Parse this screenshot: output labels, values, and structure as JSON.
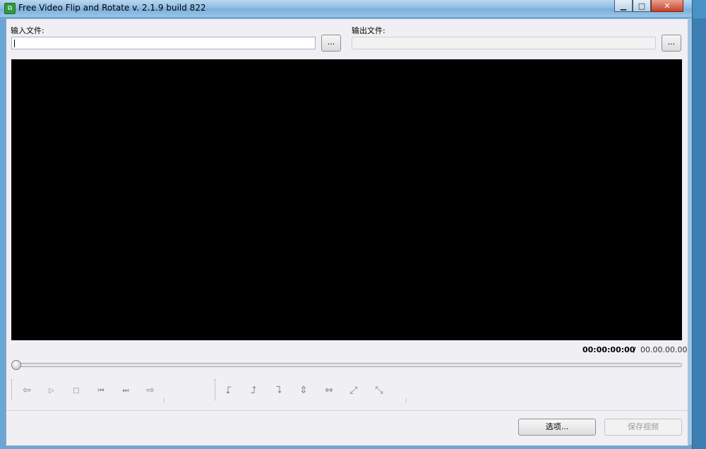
{
  "window": {
    "title": "Free Video Flip and Rotate  v. 2.1.9 build 822",
    "controls": {
      "minimize": "▁",
      "maximize": "□",
      "close": "✕"
    }
  },
  "input": {
    "label": "输入文件:",
    "value": "",
    "browse_label": "..."
  },
  "output": {
    "label": "输出文件:",
    "value": "",
    "browse_label": "..."
  },
  "player": {
    "current_time": "00:00:00:00",
    "separator": "/",
    "total_time": "00.00.00.00",
    "seek_position_fraction": 0,
    "controls": [
      {
        "name": "back-icon",
        "glyph": "⇦"
      },
      {
        "name": "play-icon",
        "glyph": "▷"
      },
      {
        "name": "stop-icon",
        "glyph": "□"
      },
      {
        "name": "prev-frame-icon",
        "glyph": "⏮"
      },
      {
        "name": "next-frame-icon",
        "glyph": "⏭"
      },
      {
        "name": "forward-icon",
        "glyph": "⇨"
      }
    ],
    "transform_tools": [
      {
        "name": "rotate-left-icon",
        "glyph": "⮦"
      },
      {
        "name": "rotate-right-icon",
        "glyph": "⮥"
      },
      {
        "name": "rotate-180-icon",
        "glyph": "⮧"
      },
      {
        "name": "flip-vertical-icon",
        "glyph": "⇕"
      },
      {
        "name": "flip-horizontal-icon",
        "glyph": "⇔"
      },
      {
        "name": "transpose-icon",
        "glyph": "⤢"
      },
      {
        "name": "transverse-icon",
        "glyph": "⤡"
      }
    ]
  },
  "footer": {
    "options_label": "选项...",
    "save_label": "保存视频"
  },
  "colors": {
    "video_bg": "#000000",
    "window_bg": "#f0eff3"
  }
}
